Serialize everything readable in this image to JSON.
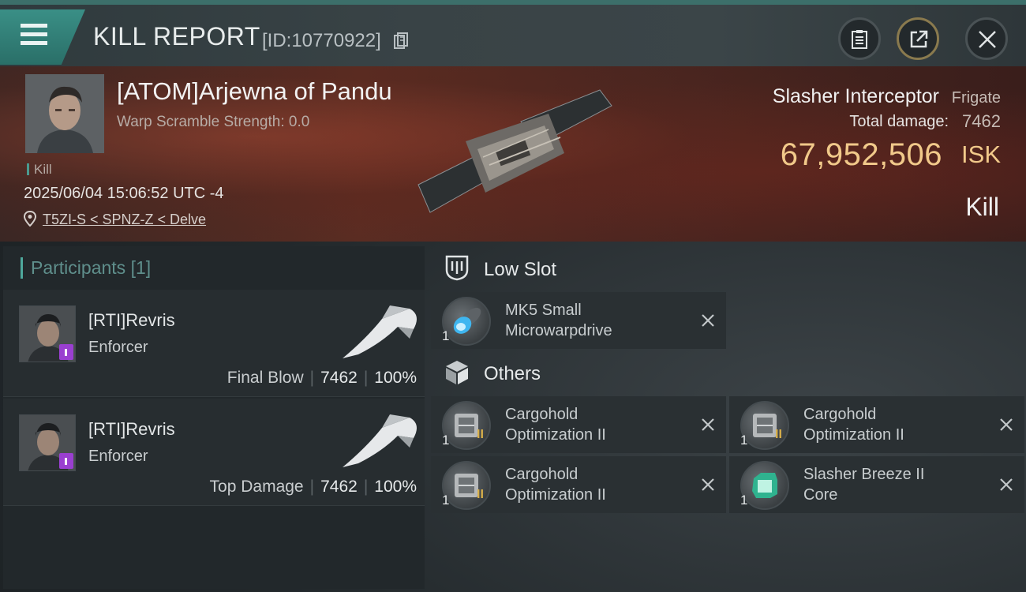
{
  "header": {
    "title": "KILL REPORT",
    "report_id": "[ID:10770922]"
  },
  "victim": {
    "name": "[ATOM]Arjewna of Pandu",
    "scramble": "Warp Scramble Strength: 0.0",
    "kill_tag": "Kill",
    "datetime": "2025/06/04 15:06:52 UTC -4",
    "location": "T5ZI-S < SPNZ-Z < Delve",
    "ship_name": "Slasher Interceptor",
    "ship_class": "Frigate",
    "damage_label": "Total damage:",
    "damage_value": "7462",
    "isk_value": "67,952,506",
    "isk_unit": "ISK",
    "result": "Kill"
  },
  "participants": {
    "header": "Participants",
    "count": "[1]",
    "rows": [
      {
        "name": "[RTI]Revris",
        "ship": "Enforcer",
        "label": "Final Blow",
        "damage": "7462",
        "percent": "100%"
      },
      {
        "name": "[RTI]Revris",
        "ship": "Enforcer",
        "label": "Top Damage",
        "damage": "7462",
        "percent": "100%"
      }
    ]
  },
  "slots": {
    "low": {
      "title": "Low Slot",
      "items": [
        {
          "qty": "1",
          "tier": "",
          "name_line1": "MK5 Small",
          "name_line2": "Microwarpdrive",
          "icon": "microwarpdrive-icon"
        }
      ]
    },
    "others": {
      "title": "Others",
      "items": [
        {
          "qty": "1",
          "tier": "II",
          "name_line1": "Cargohold",
          "name_line2": "Optimization II",
          "icon": "cargohold-icon"
        },
        {
          "qty": "1",
          "tier": "II",
          "name_line1": "Cargohold",
          "name_line2": "Optimization II",
          "icon": "cargohold-icon"
        },
        {
          "qty": "1",
          "tier": "II",
          "name_line1": "Cargohold",
          "name_line2": "Optimization II",
          "icon": "cargohold-icon"
        },
        {
          "qty": "1",
          "tier": "",
          "name_line1": "Slasher Breeze II",
          "name_line2": "Core",
          "icon": "ship-core-icon"
        }
      ]
    }
  },
  "colors": {
    "accent": "#3a8f86",
    "isk": "#f1c98a",
    "tier": "#d9b04a"
  }
}
